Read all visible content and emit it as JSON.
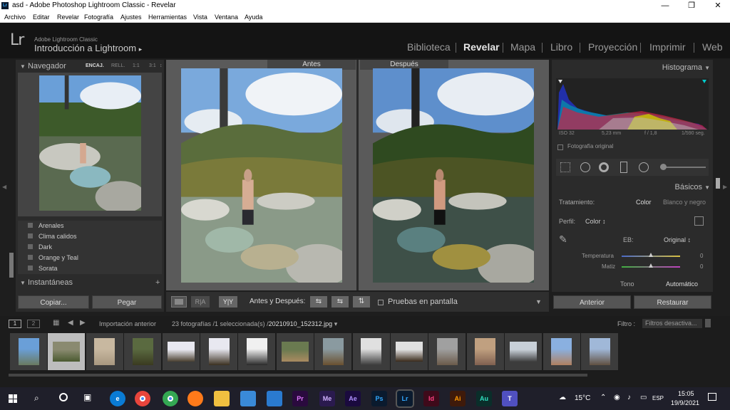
{
  "window": {
    "title": "asd - Adobe Photoshop Lightroom Classic - Revelar",
    "minimize": "—",
    "maximize": "❐",
    "close": "✕",
    "app_icon": "Lr"
  },
  "menu": [
    "Archivo",
    "Editar",
    "Revelar",
    "Fotografía",
    "Ajustes",
    "Herramientas",
    "Vista",
    "Ventana",
    "Ayuda"
  ],
  "header": {
    "logo": "Lr",
    "subtitle": "Adobe Lightroom Classic",
    "catalog": "Introducción a Lightroom",
    "catalog_arrow": "▸"
  },
  "modules": [
    "Biblioteca",
    "Revelar",
    "Mapa",
    "Libro",
    "Proyección",
    "Imprimir",
    "Web"
  ],
  "active_module": "Revelar",
  "left": {
    "navigator": {
      "title": "Navegador",
      "zoom": [
        "ENCAJ.",
        "RELL.",
        "1:1",
        "3:1"
      ],
      "zoom_arrows": "↕"
    },
    "presets": [
      "Arenales",
      "Clima calidos",
      "Dark",
      "Orange y Teal",
      "Sorata"
    ],
    "snapshots": {
      "title": "Instantáneas",
      "add": "+"
    },
    "copy_button": "Copiar...",
    "paste_button": "Pegar"
  },
  "center": {
    "before_label": "Antes",
    "after_label": "Después"
  },
  "toolbar": {
    "view_a": "",
    "view_b": "R|A",
    "view_c": "Y|Y",
    "before_after": "Antes y Después:",
    "soft_proof": "Pruebas en pantalla",
    "arrow1": "⇆",
    "arrow2": "⇆",
    "arrow3": "⇅",
    "menu_arrow": "▼"
  },
  "right": {
    "histogram": {
      "title": "Histograma",
      "iso": "ISO 32",
      "focal": "5,23 mm",
      "aperture": "f / 1,8",
      "shutter": "1/590 seg.",
      "original": "Fotografía original"
    },
    "basic": {
      "title": "Básicos",
      "treatment_label": "Tratamiento:",
      "color": "Color",
      "bw": "Blanco y negro",
      "profile_label": "Perfil:",
      "profile_value": "Color ↕",
      "wb_label": "EB:",
      "wb_value": "Original ↕",
      "temp_label": "Temperatura",
      "temp_value": "0",
      "tint_label": "Matiz",
      "tint_value": "0",
      "tone_label": "Tono",
      "tone_auto": "Automático"
    },
    "prev_button": "Anterior",
    "reset_button": "Restaurar"
  },
  "filmstrip": {
    "screen1": "1",
    "screen2": "2",
    "source": "Importación anterior",
    "info": "23 fotografías /1 seleccionada(s) /",
    "filename": "20210910_152312.jpg",
    "filename_arrow": "▾",
    "filter_label": "Filtro :",
    "filter_value": "Filtros desactiva...",
    "thumbs": 16,
    "selected": 1
  },
  "taskbar": {
    "temp": "15°C",
    "lang": "ESP",
    "time": "15:05",
    "date": "19/9/2021"
  },
  "colors": {
    "accent": "#4a90d9",
    "bg": "#2b2b2b"
  }
}
